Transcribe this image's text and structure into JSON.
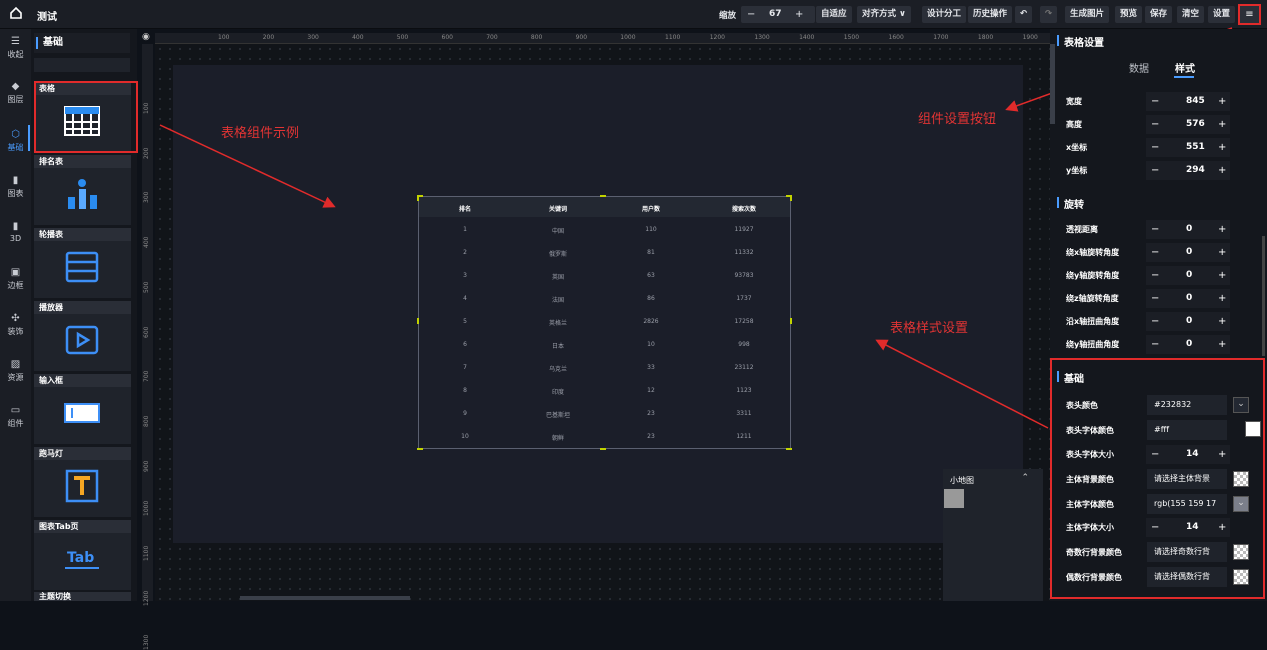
{
  "topbar": {
    "title": "测试",
    "zoom_label": "缩放",
    "zoom_minus": "−",
    "zoom_value": "67",
    "zoom_plus": "+",
    "buttons": [
      "自适应",
      "对齐方式 ∨",
      "设计分工",
      "历史操作",
      "↶",
      "↷",
      "生成图片",
      "预览",
      "保存",
      "清空",
      "设置"
    ],
    "menu": "≡"
  },
  "nav": {
    "items": [
      {
        "label": "收起",
        "icon": "☰"
      },
      {
        "label": "图层",
        "icon": "◆"
      },
      {
        "label": "基础",
        "icon": "⬡"
      },
      {
        "label": "图表",
        "icon": "▮"
      },
      {
        "label": "3D",
        "icon": "▮"
      },
      {
        "label": "边框",
        "icon": "▣"
      },
      {
        "label": "装饰",
        "icon": "✣"
      },
      {
        "label": "资源",
        "icon": "▨"
      },
      {
        "label": "组件",
        "icon": "▭"
      }
    ]
  },
  "components": {
    "header": "基础",
    "cards": [
      "表格",
      "排名表",
      "轮播表",
      "播放器",
      "输入框",
      "跑马灯",
      "图表Tab页",
      "主题切换"
    ]
  },
  "ruler": {
    "top": [
      "100",
      "200",
      "300",
      "400",
      "500",
      "600",
      "700",
      "800",
      "900",
      "1000",
      "1100",
      "1200",
      "1300",
      "1400",
      "1500",
      "1600",
      "1700",
      "1800",
      "1900"
    ],
    "left": [
      "100",
      "200",
      "300",
      "400",
      "500",
      "600",
      "700",
      "800",
      "900",
      "1000",
      "1100",
      "1200",
      "1300"
    ]
  },
  "table": {
    "columns": [
      "排名",
      "关键词",
      "用户数",
      "搜索次数"
    ],
    "rows": [
      [
        "1",
        "中国",
        "110",
        "11927"
      ],
      [
        "2",
        "俄罗斯",
        "81",
        "11332"
      ],
      [
        "3",
        "英国",
        "63",
        "93783"
      ],
      [
        "4",
        "法国",
        "86",
        "1737"
      ],
      [
        "5",
        "英格兰",
        "2826",
        "17258"
      ],
      [
        "6",
        "日本",
        "10",
        "998"
      ],
      [
        "7",
        "乌克兰",
        "33",
        "23112"
      ],
      [
        "8",
        "印度",
        "12",
        "1123"
      ],
      [
        "9",
        "巴基斯坦",
        "23",
        "3311"
      ],
      [
        "10",
        "朝鲜",
        "23",
        "1211"
      ]
    ],
    "header_bg": "#232832"
  },
  "annotations": {
    "example": "表格组件示例",
    "settings_button": "组件设置按钮",
    "style_settings": "表格样式设置"
  },
  "minimap": {
    "title": "小地图",
    "toggle": "⌃"
  },
  "panel": {
    "title": "表格设置",
    "tab_data": "数据",
    "tab_style": "样式",
    "geometry": [
      {
        "label": "宽度",
        "value": "845"
      },
      {
        "label": "高度",
        "value": "576"
      },
      {
        "label": "x坐标",
        "value": "551"
      },
      {
        "label": "y坐标",
        "value": "294"
      }
    ],
    "rotate_title": "旋转",
    "rotate": [
      {
        "label": "透视距离",
        "value": "0"
      },
      {
        "label": "绕x轴旋转角度",
        "value": "0"
      },
      {
        "label": "绕y轴旋转角度",
        "value": "0"
      },
      {
        "label": "绕z轴旋转角度",
        "value": "0"
      },
      {
        "label": "沿x轴扭曲角度",
        "value": "0"
      },
      {
        "label": "绕y轴扭曲角度",
        "value": "0"
      }
    ],
    "basic_title": "基础",
    "basic": [
      {
        "label": "表头颜色",
        "kind": "color",
        "value": "#232832"
      },
      {
        "label": "表头字体颜色",
        "kind": "color",
        "value": "#fff"
      },
      {
        "label": "表头字体大小",
        "kind": "step",
        "value": "14"
      },
      {
        "label": "主体背景颜色",
        "kind": "color",
        "value": "请选择主体背景"
      },
      {
        "label": "主体字体颜色",
        "kind": "color",
        "value": "rgb(155 159 17"
      },
      {
        "label": "主体字体大小",
        "kind": "step",
        "value": "14"
      },
      {
        "label": "奇数行背景颜色",
        "kind": "color",
        "value": "请选择奇数行背"
      },
      {
        "label": "偶数行背景颜色",
        "kind": "color",
        "value": "请选择偶数行背"
      }
    ],
    "minus": "−",
    "plus": "+"
  }
}
